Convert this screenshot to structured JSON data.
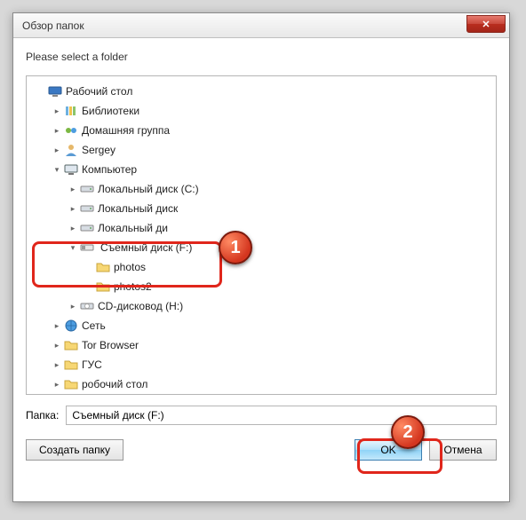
{
  "window": {
    "title": "Обзор папок",
    "close_glyph": "✕"
  },
  "prompt": "Please select a folder",
  "tree": [
    {
      "indent": 0,
      "caret": "none",
      "icon": "desktop",
      "label": "Рабочий стол"
    },
    {
      "indent": 1,
      "caret": "right",
      "icon": "libraries",
      "label": "Библиотеки"
    },
    {
      "indent": 1,
      "caret": "right",
      "icon": "homegroup",
      "label": "Домашняя группа"
    },
    {
      "indent": 1,
      "caret": "right",
      "icon": "user",
      "label": "Sergey"
    },
    {
      "indent": 1,
      "caret": "down",
      "icon": "computer",
      "label": "Компьютер"
    },
    {
      "indent": 2,
      "caret": "right",
      "icon": "drive",
      "label": "Локальный диск (C:)"
    },
    {
      "indent": 2,
      "caret": "right",
      "icon": "drive",
      "label": "Локальный диск"
    },
    {
      "indent": 2,
      "caret": "right",
      "icon": "drive",
      "label": "Локальный ди"
    },
    {
      "indent": 2,
      "caret": "down",
      "icon": "removable",
      "label": "Съемный диск (F:)",
      "selected": true
    },
    {
      "indent": 3,
      "caret": "none",
      "icon": "folder",
      "label": "photos"
    },
    {
      "indent": 3,
      "caret": "none",
      "icon": "folder",
      "label": "photos2"
    },
    {
      "indent": 2,
      "caret": "right",
      "icon": "cddrive",
      "label": "CD-дисковод (H:)"
    },
    {
      "indent": 1,
      "caret": "right",
      "icon": "network",
      "label": "Сеть"
    },
    {
      "indent": 1,
      "caret": "right",
      "icon": "folder",
      "label": "Tor Browser"
    },
    {
      "indent": 1,
      "caret": "right",
      "icon": "folder",
      "label": "ГУС"
    },
    {
      "indent": 1,
      "caret": "right",
      "icon": "folder",
      "label": "робочий стол"
    }
  ],
  "folder_field": {
    "label": "Папка:",
    "value": "Съемный диск (F:)"
  },
  "buttons": {
    "create_folder": "Создать папку",
    "ok": "OK",
    "cancel": "Отмена"
  },
  "annotations": {
    "marker1": "1",
    "marker2": "2"
  },
  "icon_svg": {
    "desktop": "<svg width='16' height='16'><rect x='1' y='3' width='14' height='8' rx='1' fill='#3a78c3' stroke='#29588f'/><rect x='5' y='12' width='6' height='2' fill='#888'/></svg>",
    "libraries": "<svg width='16' height='16'><rect x='2' y='3' width='3' height='10' fill='#6eb1e0'/><rect x='6' y='3' width='3' height='10' fill='#f0c24b'/><rect x='10' y='3' width='3' height='10' fill='#8bc56c'/></svg>",
    "homegroup": "<svg width='16' height='16'><circle cx='5' cy='8' r='3' fill='#7cb843'/><circle cx='11' cy='8' r='3' fill='#4d9de0'/></svg>",
    "user": "<svg width='16' height='16'><circle cx='8' cy='5' r='3' fill='#e6b86a'/><path d='M2 15 Q8 8 14 15 Z' fill='#5a9bd4'/></svg>",
    "computer": "<svg width='16' height='16'><rect x='1' y='3' width='14' height='8' rx='1' fill='#dfe7ef' stroke='#566'/><rect x='5' y='12' width='6' height='2' fill='#777'/></svg>",
    "drive": "<svg width='16' height='16'><rect x='1' y='5' width='14' height='6' rx='1' fill='#d7dde3' stroke='#888'/><circle cx='12' cy='8' r='1' fill='#6a6'/></svg>",
    "removable": "<svg width='16' height='16'><rect x='1' y='5' width='14' height='6' rx='1' fill='#e8e8e8' stroke='#888'/><rect x='2' y='6' width='4' height='4' fill='#999'/></svg>",
    "cddrive": "<svg width='16' height='16'><rect x='1' y='5' width='14' height='6' rx='1' fill='#d7dde3' stroke='#888'/><circle cx='8' cy='8' r='2.5' fill='#fff' stroke='#aaa'/></svg>",
    "network": "<svg width='16' height='16'><circle cx='8' cy='8' r='6' fill='#4d9de0' stroke='#2968a3'/><path d='M2 8 H14 M8 2 V14' stroke='#2968a3' stroke-width='0.8'/></svg>",
    "folder": "<svg width='16' height='16'><path d='M1 4 h5 l2 2 h7 v7 h-14 z' fill='#f7d774' stroke='#caa43c'/></svg>"
  }
}
